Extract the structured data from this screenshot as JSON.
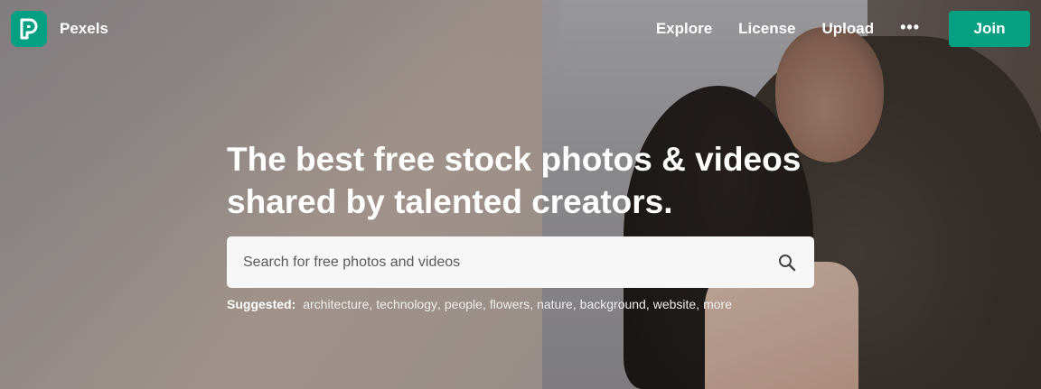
{
  "brand": {
    "name": "Pexels",
    "accent": "#05a081"
  },
  "nav": {
    "links": [
      "Explore",
      "License",
      "Upload"
    ],
    "more_label": "•••",
    "join_label": "Join"
  },
  "hero": {
    "headline_line1": "The best free stock photos & videos",
    "headline_line2": "shared by talented creators."
  },
  "search": {
    "placeholder": "Search for free photos and videos",
    "value": "",
    "icon": "search-icon"
  },
  "suggested": {
    "label": "Suggested:",
    "items": [
      "architecture",
      "technology",
      "people",
      "flowers",
      "nature",
      "background",
      "website",
      "more"
    ]
  }
}
